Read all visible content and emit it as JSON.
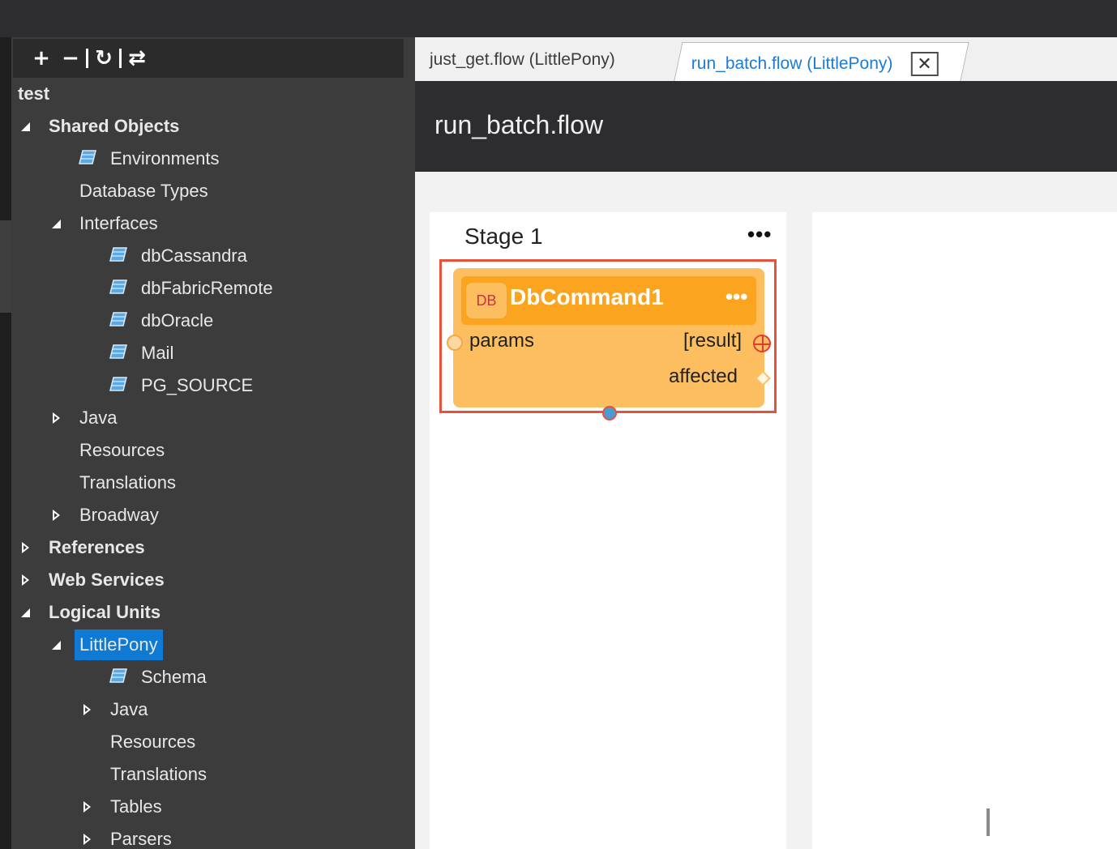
{
  "toolbar": {
    "expand": "+",
    "collapse": "−",
    "refresh": "↻",
    "sync": "⇄"
  },
  "tree": {
    "root": "test",
    "shared_objects": "Shared Objects",
    "environments": "Environments",
    "database_types": "Database Types",
    "interfaces": "Interfaces",
    "interface_items": [
      "dbCassandra",
      "dbFabricRemote",
      "dbOracle",
      "Mail",
      "PG_SOURCE"
    ],
    "java": "Java",
    "resources": "Resources",
    "translations": "Translations",
    "broadway": "Broadway",
    "references": "References",
    "web_services": "Web Services",
    "logical_units": "Logical Units",
    "lu_name": "LittlePony",
    "lu_schema": "Schema",
    "lu_java": "Java",
    "lu_resources": "Resources",
    "lu_translations": "Translations",
    "lu_tables": "Tables",
    "lu_parsers": "Parsers"
  },
  "tabs": [
    {
      "label": "just_get.flow (LittlePony)",
      "active": false
    },
    {
      "label": "run_batch.flow (LittlePony)",
      "active": true
    }
  ],
  "close_icon": "✕",
  "flow_title": "run_batch.flow",
  "stage": {
    "title": "Stage 1",
    "menu": "•••"
  },
  "actor": {
    "badge": "DB",
    "name": "DbCommand1",
    "menu": "•••",
    "input_port": "params",
    "output_ports": [
      "[result]",
      "affected"
    ]
  },
  "colors": {
    "selection": "#0e7ad3",
    "actor_fill": "#fdbe60",
    "actor_header": "#fba41f",
    "selection_border": "#e8513a",
    "active_tab_text": "#1d7bd6"
  }
}
